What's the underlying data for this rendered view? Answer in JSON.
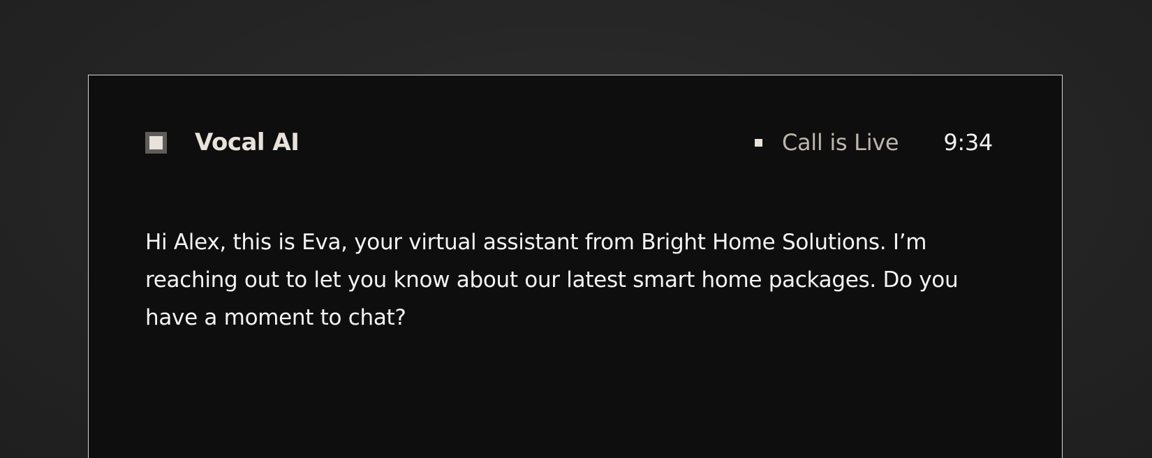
{
  "app": {
    "name": "Vocal AI",
    "logo_icon": "square-logo-icon"
  },
  "call": {
    "status_label": "Call is Live",
    "status_icon": "live-dot-icon",
    "timer": "9:34"
  },
  "transcript": {
    "message": "Hi Alex, this is Eva, your virtual assistant from Bright Home Solutions. I’m reaching out to let you know about our latest smart home packages. Do you have a moment to chat?"
  },
  "colors": {
    "background": "#262626",
    "panel": "#0e0e0e",
    "panel_border": "#d8d8d8",
    "brand_text": "#e8e2da",
    "status_text": "#bdb6ad",
    "body_text": "#f4f4f4"
  }
}
